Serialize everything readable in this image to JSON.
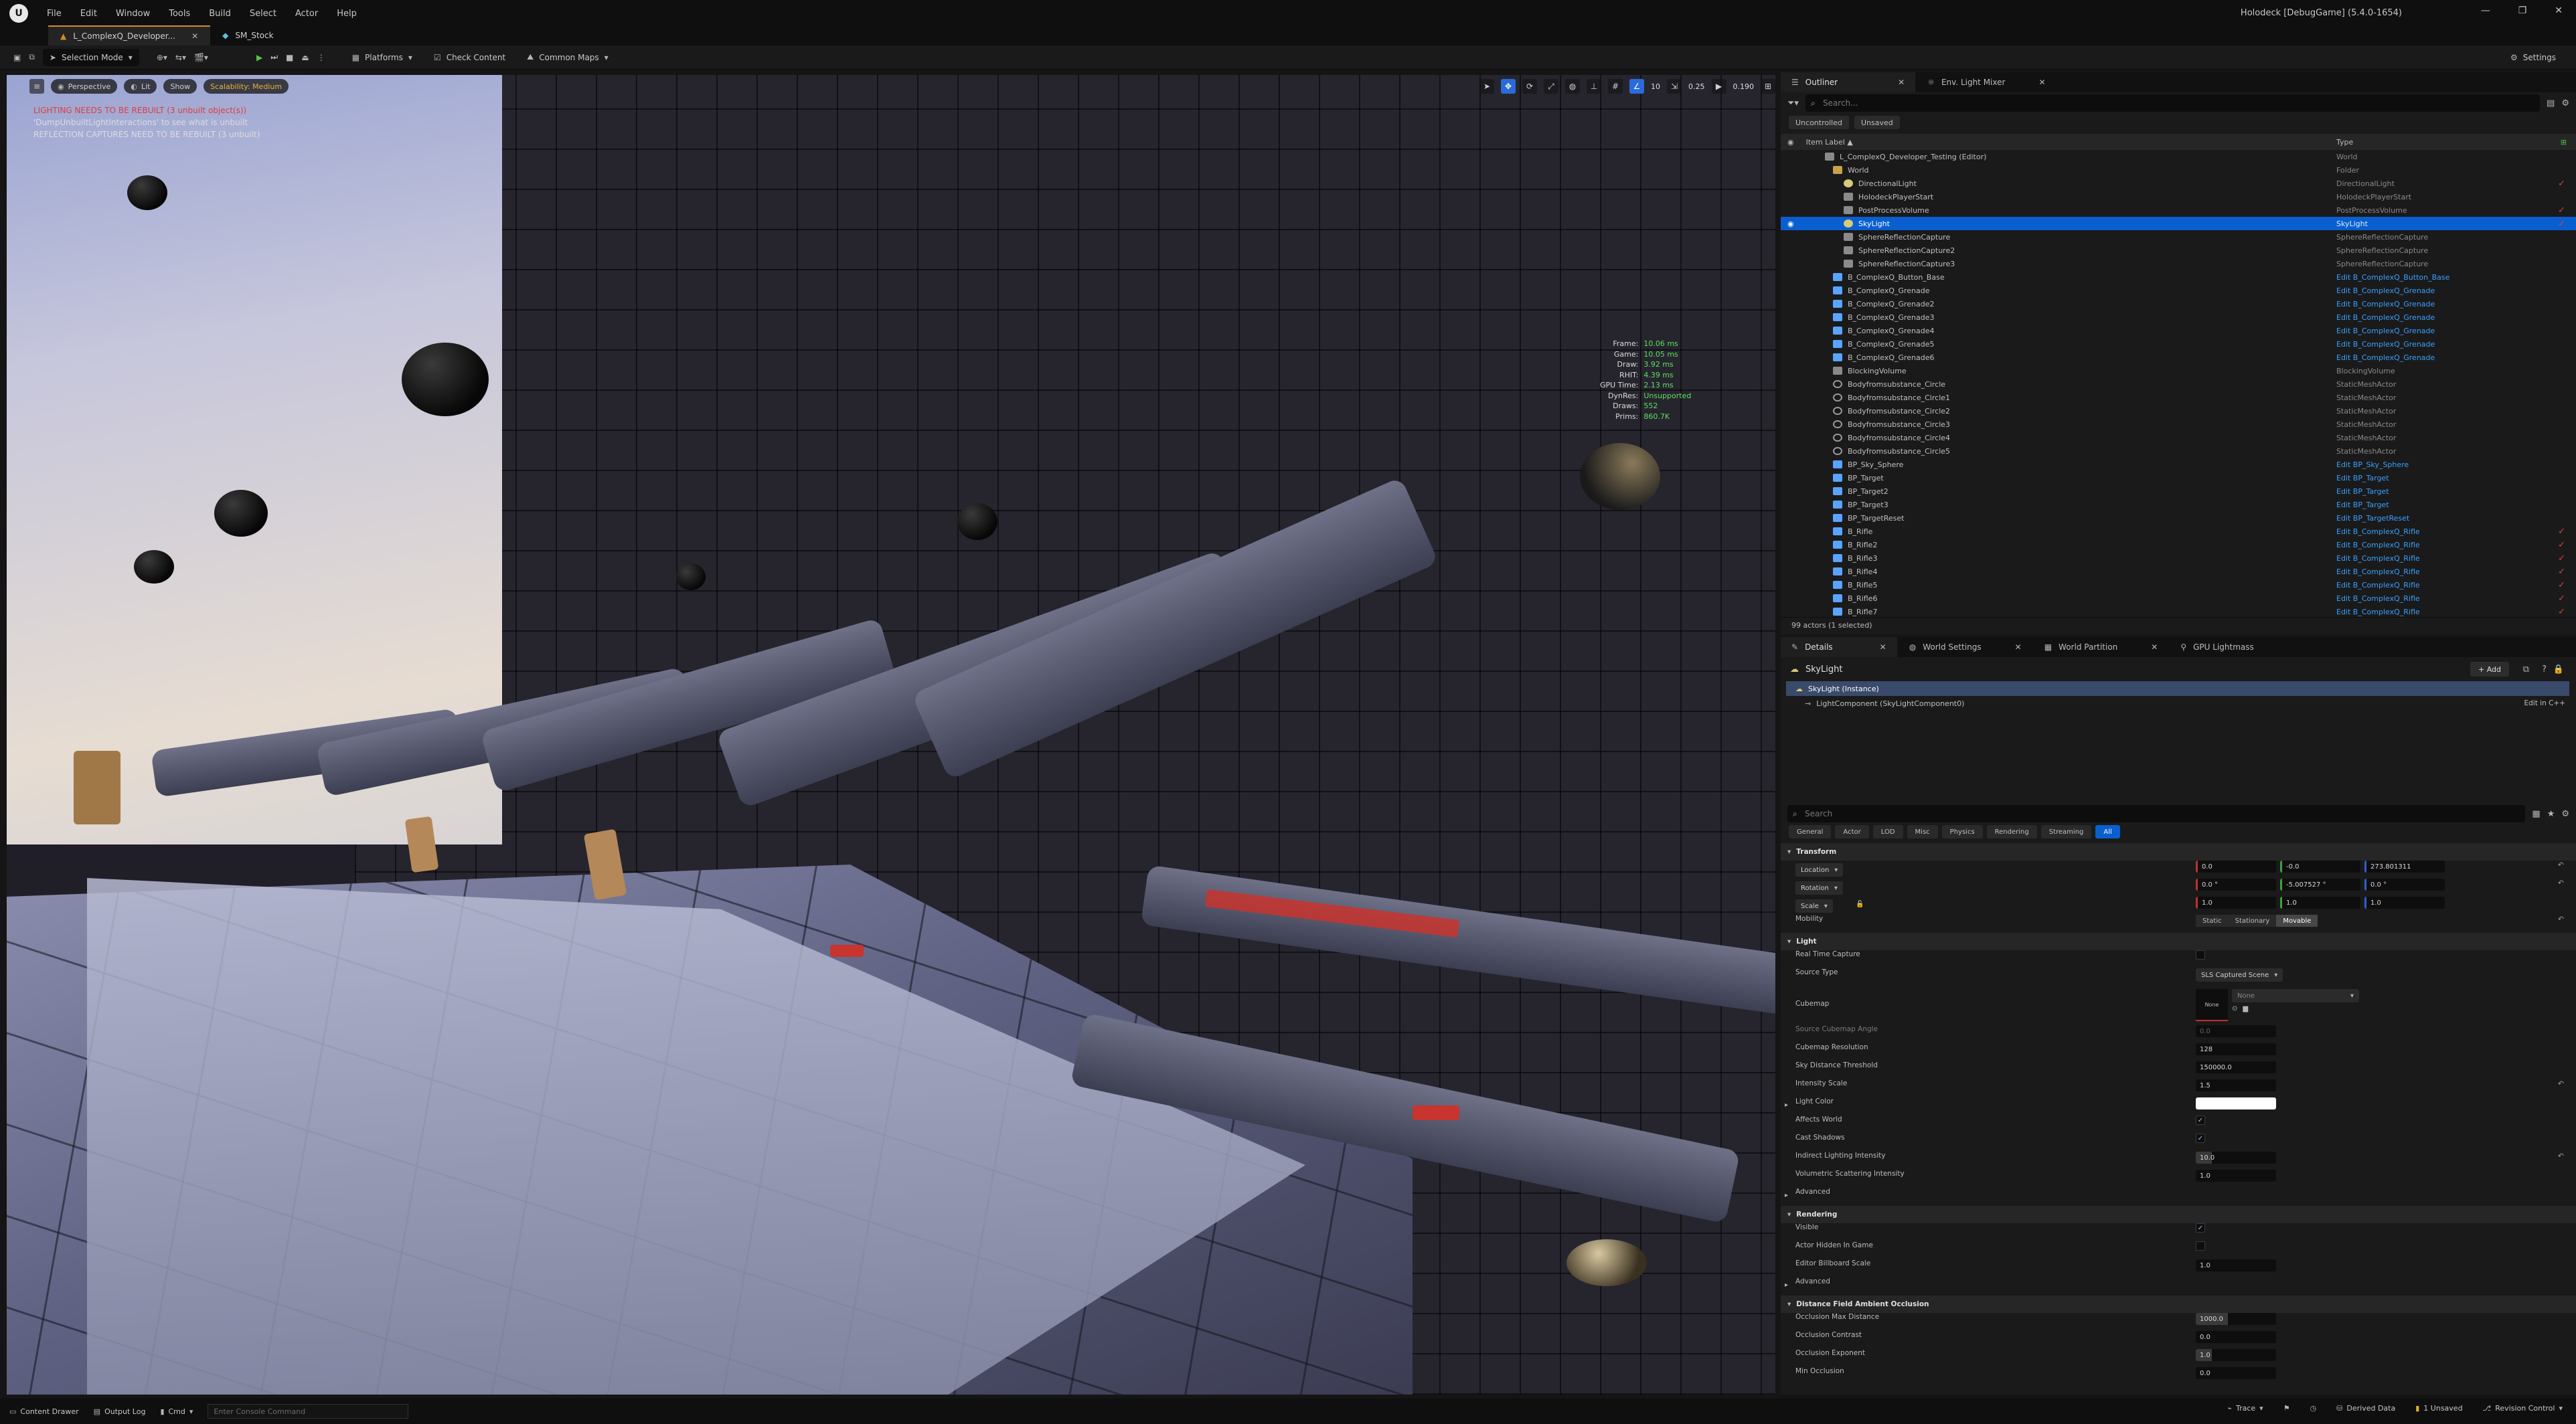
{
  "window": {
    "title": "Holodeck [DebugGame] (5.4.0-1654)",
    "menu": [
      "File",
      "Edit",
      "Window",
      "Tools",
      "Build",
      "Select",
      "Actor",
      "Help"
    ],
    "controls": [
      "—",
      "❐",
      "✕"
    ]
  },
  "tabs": [
    {
      "label": "L_ComplexQ_Developer...",
      "active": true
    },
    {
      "label": "SM_Stock",
      "active": false
    }
  ],
  "toolbar": {
    "selection_mode": "Selection Mode",
    "platforms": "Platforms",
    "check_content": "Check Content",
    "common_maps": "Common Maps",
    "settings": "Settings"
  },
  "viewport": {
    "perspective": "Perspective",
    "lit": "Lit",
    "show": "Show",
    "scalability": "Scalability: Medium",
    "snap_angle": "10",
    "snap_scale": "0.25",
    "camera_speed": "0.190",
    "messages": [
      {
        "text": "LIGHTING NEEDS TO BE REBUILT (3 unbuilt object(s))",
        "color": "#e03c3c"
      },
      {
        "text": "'DumpUnbuiltLightInteractions' to see what is unbuilt",
        "color": "#dcdcdc"
      },
      {
        "text": "REFLECTION CAPTURES NEED TO BE REBUILT (3 unbuilt)",
        "color": "#dcdcdc"
      }
    ],
    "stats": [
      {
        "key": "Frame:",
        "value": "10.06 ms"
      },
      {
        "key": "Game:",
        "value": "10.05 ms"
      },
      {
        "key": "Draw:",
        "value": "3.92 ms"
      },
      {
        "key": "RHIT:",
        "value": "4.39 ms"
      },
      {
        "key": "GPU Time:",
        "value": "2.13 ms"
      },
      {
        "key": "DynRes:",
        "value": "Unsupported"
      },
      {
        "key": "Draws:",
        "value": "552"
      },
      {
        "key": "Prims:",
        "value": "860.7K"
      }
    ]
  },
  "outliner": {
    "tab_outliner": "Outliner",
    "tab_env": "Env. Light Mixer",
    "search_placeholder": "Search...",
    "chip_uncontrolled": "Uncontrolled",
    "chip_unsaved": "Unsaved",
    "col_label": "Item Label ▲",
    "col_type": "Type",
    "footer": "99 actors (1 selected)",
    "rows": [
      {
        "label": "L_ComplexQ_Developer_Testing (Editor)",
        "type": "World",
        "indent": 1,
        "icon": "actor",
        "link": false,
        "check": false,
        "selected": false
      },
      {
        "label": "World",
        "type": "Folder",
        "indent": 2,
        "icon": "folder",
        "link": false,
        "check": false,
        "selected": false
      },
      {
        "label": "DirectionalLight",
        "type": "DirectionalLight",
        "indent": 3,
        "icon": "light",
        "link": false,
        "check": true,
        "selected": false
      },
      {
        "label": "HolodeckPlayerStart",
        "type": "HolodeckPlayerStart",
        "indent": 3,
        "icon": "actor",
        "link": false,
        "check": false,
        "selected": false
      },
      {
        "label": "PostProcessVolume",
        "type": "PostProcessVolume",
        "indent": 3,
        "icon": "actor",
        "link": false,
        "check": true,
        "selected": false
      },
      {
        "label": "SkyLight",
        "type": "SkyLight",
        "indent": 3,
        "icon": "light",
        "link": false,
        "check": true,
        "selected": true
      },
      {
        "label": "SphereReflectionCapture",
        "type": "SphereReflectionCapture",
        "indent": 3,
        "icon": "actor",
        "link": false,
        "check": false,
        "selected": false
      },
      {
        "label": "SphereReflectionCapture2",
        "type": "SphereReflectionCapture",
        "indent": 3,
        "icon": "actor",
        "link": false,
        "check": false,
        "selected": false
      },
      {
        "label": "SphereReflectionCapture3",
        "type": "SphereReflectionCapture",
        "indent": 3,
        "icon": "actor",
        "link": false,
        "check": false,
        "selected": false
      },
      {
        "label": "B_ComplexQ_Button_Base",
        "type": "Edit B_ComplexQ_Button_Base",
        "indent": 2,
        "icon": "bp",
        "link": true,
        "check": false,
        "selected": false
      },
      {
        "label": "B_ComplexQ_Grenade",
        "type": "Edit B_ComplexQ_Grenade",
        "indent": 2,
        "icon": "bp",
        "link": true,
        "check": false,
        "selected": false
      },
      {
        "label": "B_ComplexQ_Grenade2",
        "type": "Edit B_ComplexQ_Grenade",
        "indent": 2,
        "icon": "bp",
        "link": true,
        "check": false,
        "selected": false
      },
      {
        "label": "B_ComplexQ_Grenade3",
        "type": "Edit B_ComplexQ_Grenade",
        "indent": 2,
        "icon": "bp",
        "link": true,
        "check": false,
        "selected": false
      },
      {
        "label": "B_ComplexQ_Grenade4",
        "type": "Edit B_ComplexQ_Grenade",
        "indent": 2,
        "icon": "bp",
        "link": true,
        "check": false,
        "selected": false
      },
      {
        "label": "B_ComplexQ_Grenade5",
        "type": "Edit B_ComplexQ_Grenade",
        "indent": 2,
        "icon": "bp",
        "link": true,
        "check": false,
        "selected": false
      },
      {
        "label": "B_ComplexQ_Grenade6",
        "type": "Edit B_ComplexQ_Grenade",
        "indent": 2,
        "icon": "bp",
        "link": true,
        "check": false,
        "selected": false
      },
      {
        "label": "BlockingVolume",
        "type": "BlockingVolume",
        "indent": 2,
        "icon": "actor",
        "link": false,
        "check": false,
        "selected": false
      },
      {
        "label": "Bodyfromsubstance_Circle",
        "type": "StaticMeshActor",
        "indent": 2,
        "icon": "mesh",
        "link": false,
        "check": false,
        "selected": false
      },
      {
        "label": "Bodyfromsubstance_Circle1",
        "type": "StaticMeshActor",
        "indent": 2,
        "icon": "mesh",
        "link": false,
        "check": false,
        "selected": false
      },
      {
        "label": "Bodyfromsubstance_Circle2",
        "type": "StaticMeshActor",
        "indent": 2,
        "icon": "mesh",
        "link": false,
        "check": false,
        "selected": false
      },
      {
        "label": "Bodyfromsubstance_Circle3",
        "type": "StaticMeshActor",
        "indent": 2,
        "icon": "mesh",
        "link": false,
        "check": false,
        "selected": false
      },
      {
        "label": "Bodyfromsubstance_Circle4",
        "type": "StaticMeshActor",
        "indent": 2,
        "icon": "mesh",
        "link": false,
        "check": false,
        "selected": false
      },
      {
        "label": "Bodyfromsubstance_Circle5",
        "type": "StaticMeshActor",
        "indent": 2,
        "icon": "mesh",
        "link": false,
        "check": false,
        "selected": false
      },
      {
        "label": "BP_Sky_Sphere",
        "type": "Edit BP_Sky_Sphere",
        "indent": 2,
        "icon": "bp",
        "link": true,
        "check": false,
        "selected": false
      },
      {
        "label": "BP_Target",
        "type": "Edit BP_Target",
        "indent": 2,
        "icon": "bp",
        "link": true,
        "check": false,
        "selected": false
      },
      {
        "label": "BP_Target2",
        "type": "Edit BP_Target",
        "indent": 2,
        "icon": "bp",
        "link": true,
        "check": false,
        "selected": false
      },
      {
        "label": "BP_Target3",
        "type": "Edit BP_Target",
        "indent": 2,
        "icon": "bp",
        "link": true,
        "check": false,
        "selected": false
      },
      {
        "label": "BP_TargetReset",
        "type": "Edit BP_TargetReset",
        "indent": 2,
        "icon": "bp",
        "link": true,
        "check": false,
        "selected": false
      },
      {
        "label": "B_Rifle",
        "type": "Edit B_ComplexQ_Rifle",
        "indent": 2,
        "icon": "bp",
        "link": true,
        "check": true,
        "selected": false
      },
      {
        "label": "B_Rifle2",
        "type": "Edit B_ComplexQ_Rifle",
        "indent": 2,
        "icon": "bp",
        "link": true,
        "check": true,
        "selected": false
      },
      {
        "label": "B_Rifle3",
        "type": "Edit B_ComplexQ_Rifle",
        "indent": 2,
        "icon": "bp",
        "link": true,
        "check": true,
        "selected": false
      },
      {
        "label": "B_Rifle4",
        "type": "Edit B_ComplexQ_Rifle",
        "indent": 2,
        "icon": "bp",
        "link": true,
        "check": true,
        "selected": false
      },
      {
        "label": "B_Rifle5",
        "type": "Edit B_ComplexQ_Rifle",
        "indent": 2,
        "icon": "bp",
        "link": true,
        "check": true,
        "selected": false
      },
      {
        "label": "B_Rifle6",
        "type": "Edit B_ComplexQ_Rifle",
        "indent": 2,
        "icon": "bp",
        "link": true,
        "check": true,
        "selected": false
      },
      {
        "label": "B_Rifle7",
        "type": "Edit B_ComplexQ_Rifle",
        "indent": 2,
        "icon": "bp",
        "link": true,
        "check": true,
        "selected": false
      }
    ]
  },
  "details": {
    "tabs": [
      {
        "label": "Details",
        "active": true
      },
      {
        "label": "World Settings",
        "active": false
      },
      {
        "label": "World Partition",
        "active": false
      },
      {
        "label": "GPU Lightmass",
        "active": false
      }
    ],
    "actor_name": "SkyLight",
    "add_label": "+ Add",
    "instance_label": "SkyLight (Instance)",
    "component_label": "LightComponent (SkyLightComponent0)",
    "edit_cpp": "Edit in C++",
    "search_placeholder": "Search",
    "filters": [
      "General",
      "Actor",
      "LOD",
      "Misc",
      "Physics",
      "Rendering",
      "Streaming",
      "All"
    ],
    "active_filter": "All",
    "transform": {
      "title": "Transform",
      "location_label": "Location",
      "location": [
        "0.0",
        "-0.0",
        "273.801311"
      ],
      "rotation_label": "Rotation",
      "rotation": [
        "0.0 °",
        "-5.007527 °",
        "0.0 °"
      ],
      "scale_label": "Scale",
      "scale": [
        "1.0",
        "1.0",
        "1.0"
      ],
      "mobility_label": "Mobility",
      "mobility_options": [
        "Static",
        "Stationary",
        "Movable"
      ],
      "mobility_selected": "Movable"
    },
    "light": {
      "title": "Light",
      "real_time_capture": "Real Time Capture",
      "source_type_label": "Source Type",
      "source_type": "SLS Captured Scene",
      "cubemap_label": "Cubemap",
      "cubemap_thumb": "None",
      "cubemap_value": "None",
      "source_cubemap_angle_label": "Source Cubemap Angle",
      "source_cubemap_angle": "0.0",
      "cubemap_resolution_label": "Cubemap Resolution",
      "cubemap_resolution": "128",
      "sky_distance_label": "Sky Distance Threshold",
      "sky_distance": "150000.0",
      "intensity_scale_label": "Intensity Scale",
      "intensity_scale": "1.5",
      "light_color_label": "Light Color",
      "affects_world_label": "Affects World",
      "cast_shadows_label": "Cast Shadows",
      "indirect_label": "Indirect Lighting Intensity",
      "indirect": "10.0",
      "volumetric_label": "Volumetric Scattering Intensity",
      "volumetric": "1.0",
      "advanced": "Advanced"
    },
    "rendering": {
      "title": "Rendering",
      "visible_label": "Visible",
      "actor_hidden_label": "Actor Hidden In Game",
      "billboard_label": "Editor Billboard Scale",
      "billboard": "1.0",
      "advanced": "Advanced"
    },
    "dfao": {
      "title": "Distance Field Ambient Occlusion",
      "max_distance_label": "Occlusion Max Distance",
      "max_distance": "1000.0",
      "contrast_label": "Occlusion Contrast",
      "contrast": "0.0",
      "exponent_label": "Occlusion Exponent",
      "exponent": "1.0",
      "min_occlusion_label": "Min Occlusion",
      "min_occlusion": "0.0"
    }
  },
  "statusbar": {
    "content_drawer": "Content Drawer",
    "output_log": "Output Log",
    "cmd": "Cmd",
    "console_placeholder": "Enter Console Command",
    "trace": "Trace",
    "derived_data": "Derived Data",
    "unsaved": "1 Unsaved",
    "revision_control": "Revision Control"
  },
  "colors": {
    "accent": "#0a5fd0",
    "error": "#e03c3c",
    "stats_value": "#5ee05e"
  }
}
